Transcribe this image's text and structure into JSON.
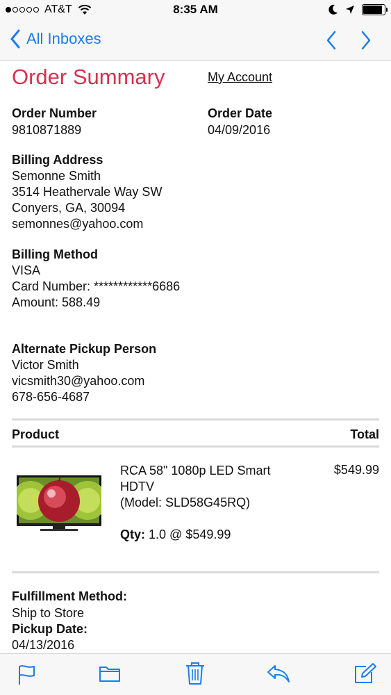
{
  "status_bar": {
    "carrier": "AT&T",
    "time": "8:35 AM",
    "battery_level": 0.92
  },
  "nav": {
    "back_label": "All Inboxes",
    "accent_color": "#1a7cf0"
  },
  "email": {
    "title": "Order Summary",
    "title_color": "#d6314f",
    "account_link": "My Account",
    "order_number_label": "Order Number",
    "order_number": "9810871889",
    "order_date_label": "Order Date",
    "order_date": "04/09/2016",
    "billing_address_label": "Billing Address",
    "billing_address": [
      "Semonne Smith",
      "3514 Heathervale Way SW",
      "Conyers, GA, 30094",
      "semonnes@yahoo.com"
    ],
    "billing_method_label": "Billing Method",
    "billing_method": [
      "VISA",
      "Card Number: ************6686",
      "Amount: 588.49"
    ],
    "alternate_pickup_label": "Alternate Pickup Person",
    "alternate_pickup": [
      "Victor Smith",
      "vicsmith30@yahoo.com",
      "678-656-4687"
    ],
    "table": {
      "product_header": "Product",
      "total_header": "Total"
    },
    "product": {
      "image_icon": "tv-product-image",
      "description_lines": [
        "RCA 58\" 1080p LED Smart",
        "HDTV",
        "(Model: SLD58G45RQ)"
      ],
      "price": "$549.99",
      "qty_label": "Qty:",
      "qty_value": "1.0 @ $549.99"
    },
    "fulfillment_method_label": "Fulfillment Method:",
    "fulfillment_method": "Ship to Store",
    "pickup_date_label": "Pickup Date:",
    "pickup_date": "04/13/2016"
  },
  "toolbar": {
    "icons": [
      "flag-icon",
      "folder-icon",
      "trash-icon",
      "reply-icon",
      "compose-icon"
    ]
  }
}
